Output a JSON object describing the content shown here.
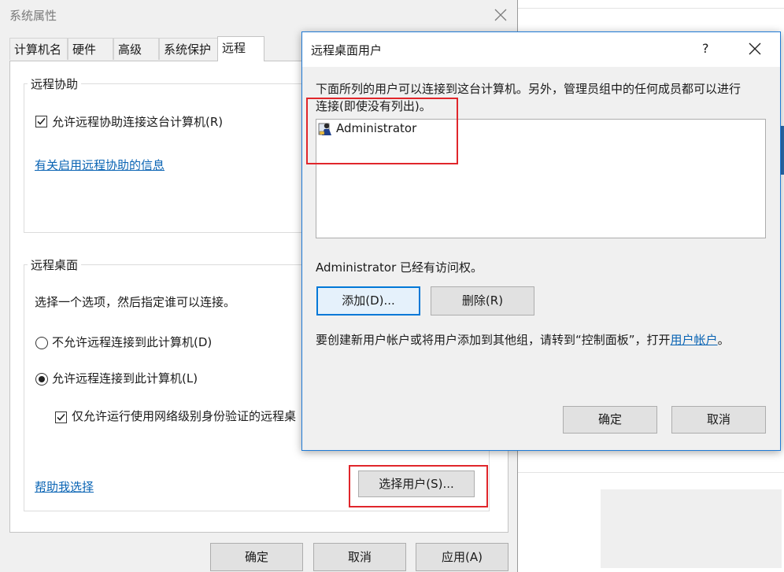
{
  "sys_dialog": {
    "title": "系统属性",
    "tabs": [
      "计算机名",
      "硬件",
      "高级",
      "系统保护",
      "远程"
    ],
    "remote_assist": {
      "legend": "远程协助",
      "checkbox_label": "允许远程协助连接这台计算机(R)",
      "checkbox_checked": true,
      "info_link": "有关启用远程协助的信息"
    },
    "remote_desktop": {
      "legend": "远程桌面",
      "instruction": "选择一个选项，然后指定谁可以连接。",
      "option_disallow": "不允许远程连接到此计算机(D)",
      "option_allow": "允许远程连接到此计算机(L)",
      "selected_option": "allow",
      "nla_label": "仅允许运行使用网络级别身份验证的远程桌",
      "nla_checked": true,
      "help_link": "帮助我选择",
      "select_users_button": "选择用户(S)..."
    },
    "buttons": {
      "ok": "确定",
      "cancel": "取消",
      "apply": "应用(A)"
    }
  },
  "rdu_dialog": {
    "title": "远程桌面用户",
    "help_glyph": "?",
    "close_glyph": "✕",
    "description_line1": "下面所列的用户可以连接到这台计算机。另外，管理员组中的任何成员都可以进行",
    "description_line2": "连接(即使没有列出)。",
    "users": [
      {
        "name": "Administrator",
        "icon": "user-icon"
      }
    ],
    "access_status": "Administrator 已经有访问权。",
    "add_button": "添加(D)...",
    "remove_button": "删除(R)",
    "footer_text": "要创建新用户帐户或将用户添加到其他组，请转到“控制面板”，打开",
    "footer_link": "用户帐户",
    "footer_end": "。",
    "ok_button": "确定",
    "cancel_button": "取消"
  },
  "colors": {
    "accent": "#0078d7",
    "link": "#0a64b4",
    "highlight_box": "#e0262b"
  }
}
